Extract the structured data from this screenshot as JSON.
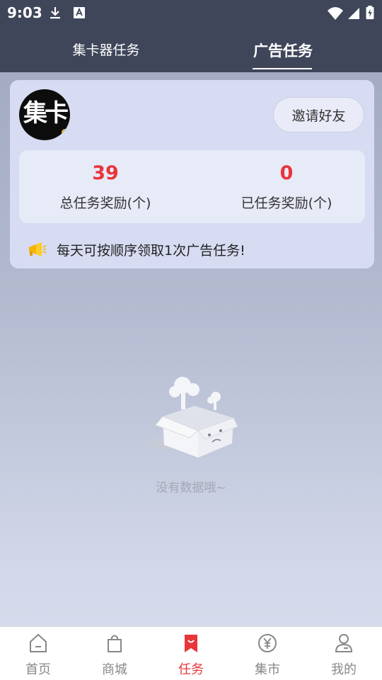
{
  "status_bar": {
    "time": "9:03",
    "left_icons": [
      "download-icon",
      "font-icon"
    ],
    "right_icons": [
      "wifi-icon",
      "signal-icon",
      "battery-icon"
    ]
  },
  "tabs": [
    {
      "label": "集卡器任务",
      "active": false
    },
    {
      "label": "广告任务",
      "active": true
    }
  ],
  "card": {
    "avatar_text": "集卡",
    "invite_button": "邀请好友",
    "stats": [
      {
        "value": "39",
        "label": "总任务奖励(个)"
      },
      {
        "value": "0",
        "label": "已任务奖励(个)"
      }
    ],
    "notice_icon": "megaphone-icon",
    "notice": "每天可按顺序领取1次广告任务!"
  },
  "empty_state": {
    "icon": "empty-box-icon",
    "text": "没有数据哦~"
  },
  "bottom_nav": [
    {
      "label": "首页",
      "icon": "home-icon",
      "active": false
    },
    {
      "label": "商城",
      "icon": "shopping-bag-icon",
      "active": false
    },
    {
      "label": "任务",
      "icon": "task-bookmark-icon",
      "active": true
    },
    {
      "label": "集市",
      "icon": "yuan-coin-icon",
      "active": false
    },
    {
      "label": "我的",
      "icon": "user-icon",
      "active": false
    }
  ],
  "colors": {
    "header_bg": "#3f465a",
    "accent_red": "#e8353a",
    "card_bg": "#d7dcf2",
    "nav_inactive": "#888888"
  }
}
